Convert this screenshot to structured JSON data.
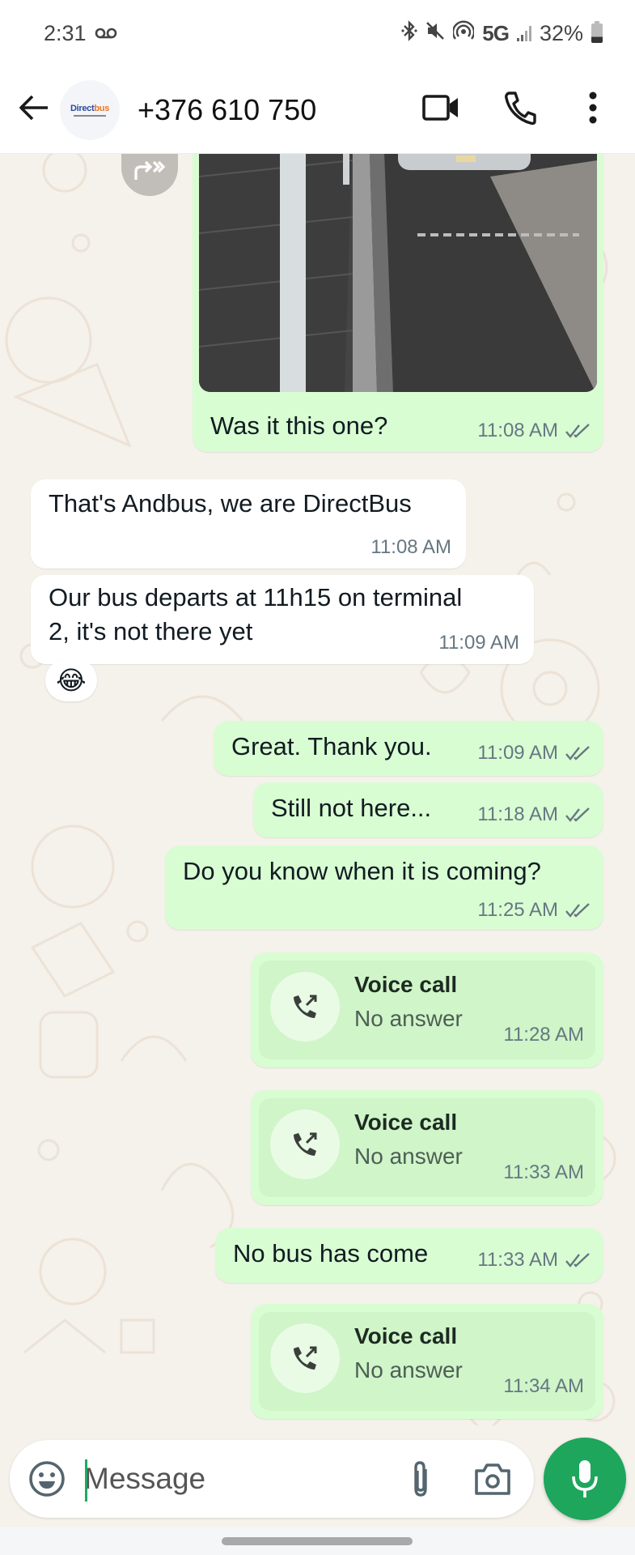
{
  "status_bar": {
    "time": "2:31",
    "voicemail_icon": "voicemail-icon",
    "icons": [
      "bluetooth-icon",
      "mute-icon",
      "hotspot-icon"
    ],
    "network": "5G",
    "battery_percent": "32%",
    "battery_level": 0.32
  },
  "header": {
    "back_icon": "arrow-left-icon",
    "avatar": {
      "logo_part1": "Direct",
      "logo_part2": "bus"
    },
    "contact_name": "+376 610 750",
    "video_call_icon": "video-icon",
    "voice_call_icon": "phone-icon",
    "more_icon": "more-vert-icon"
  },
  "colors": {
    "outgoing_bubble": "#d9fdd3",
    "incoming_bubble": "#ffffff",
    "chat_background": "#f5f1eb",
    "accent_green": "#1da65c",
    "meta_text": "#667781"
  },
  "messages": [
    {
      "type": "image",
      "direction": "outgoing",
      "caption": "Was it this one?",
      "time": "11:08 AM",
      "status": "read",
      "forward_icon": "forward-icon"
    },
    {
      "type": "text",
      "direction": "incoming",
      "text": "That's Andbus, we are DirectBus",
      "time": "11:08 AM"
    },
    {
      "type": "text",
      "direction": "incoming",
      "text_line1": "Our bus departs at 11h15 on terminal",
      "text_line2": "2, it's not there yet",
      "time": "11:09 AM",
      "reaction": "😂"
    },
    {
      "type": "text",
      "direction": "outgoing",
      "text": "Great. Thank you.",
      "time": "11:09 AM",
      "status": "read"
    },
    {
      "type": "text",
      "direction": "outgoing",
      "text": "Still not here...",
      "time": "11:18 AM",
      "status": "read"
    },
    {
      "type": "text",
      "direction": "outgoing",
      "text": "Do you know when it is coming?",
      "time": "11:25 AM",
      "status": "read"
    },
    {
      "type": "call",
      "direction": "outgoing",
      "title": "Voice call",
      "subtitle": "No answer",
      "time": "11:28 AM"
    },
    {
      "type": "call",
      "direction": "outgoing",
      "title": "Voice call",
      "subtitle": "No answer",
      "time": "11:33 AM"
    },
    {
      "type": "text",
      "direction": "outgoing",
      "text": "No bus has come",
      "time": "11:33 AM",
      "status": "read"
    },
    {
      "type": "call",
      "direction": "outgoing",
      "title": "Voice call",
      "subtitle": "No answer",
      "time": "11:34 AM"
    }
  ],
  "composer": {
    "placeholder": "Message",
    "value": "",
    "emoji_icon": "emoji-icon",
    "attach_icon": "paperclip-icon",
    "camera_icon": "camera-icon",
    "mic_icon": "microphone-icon"
  }
}
